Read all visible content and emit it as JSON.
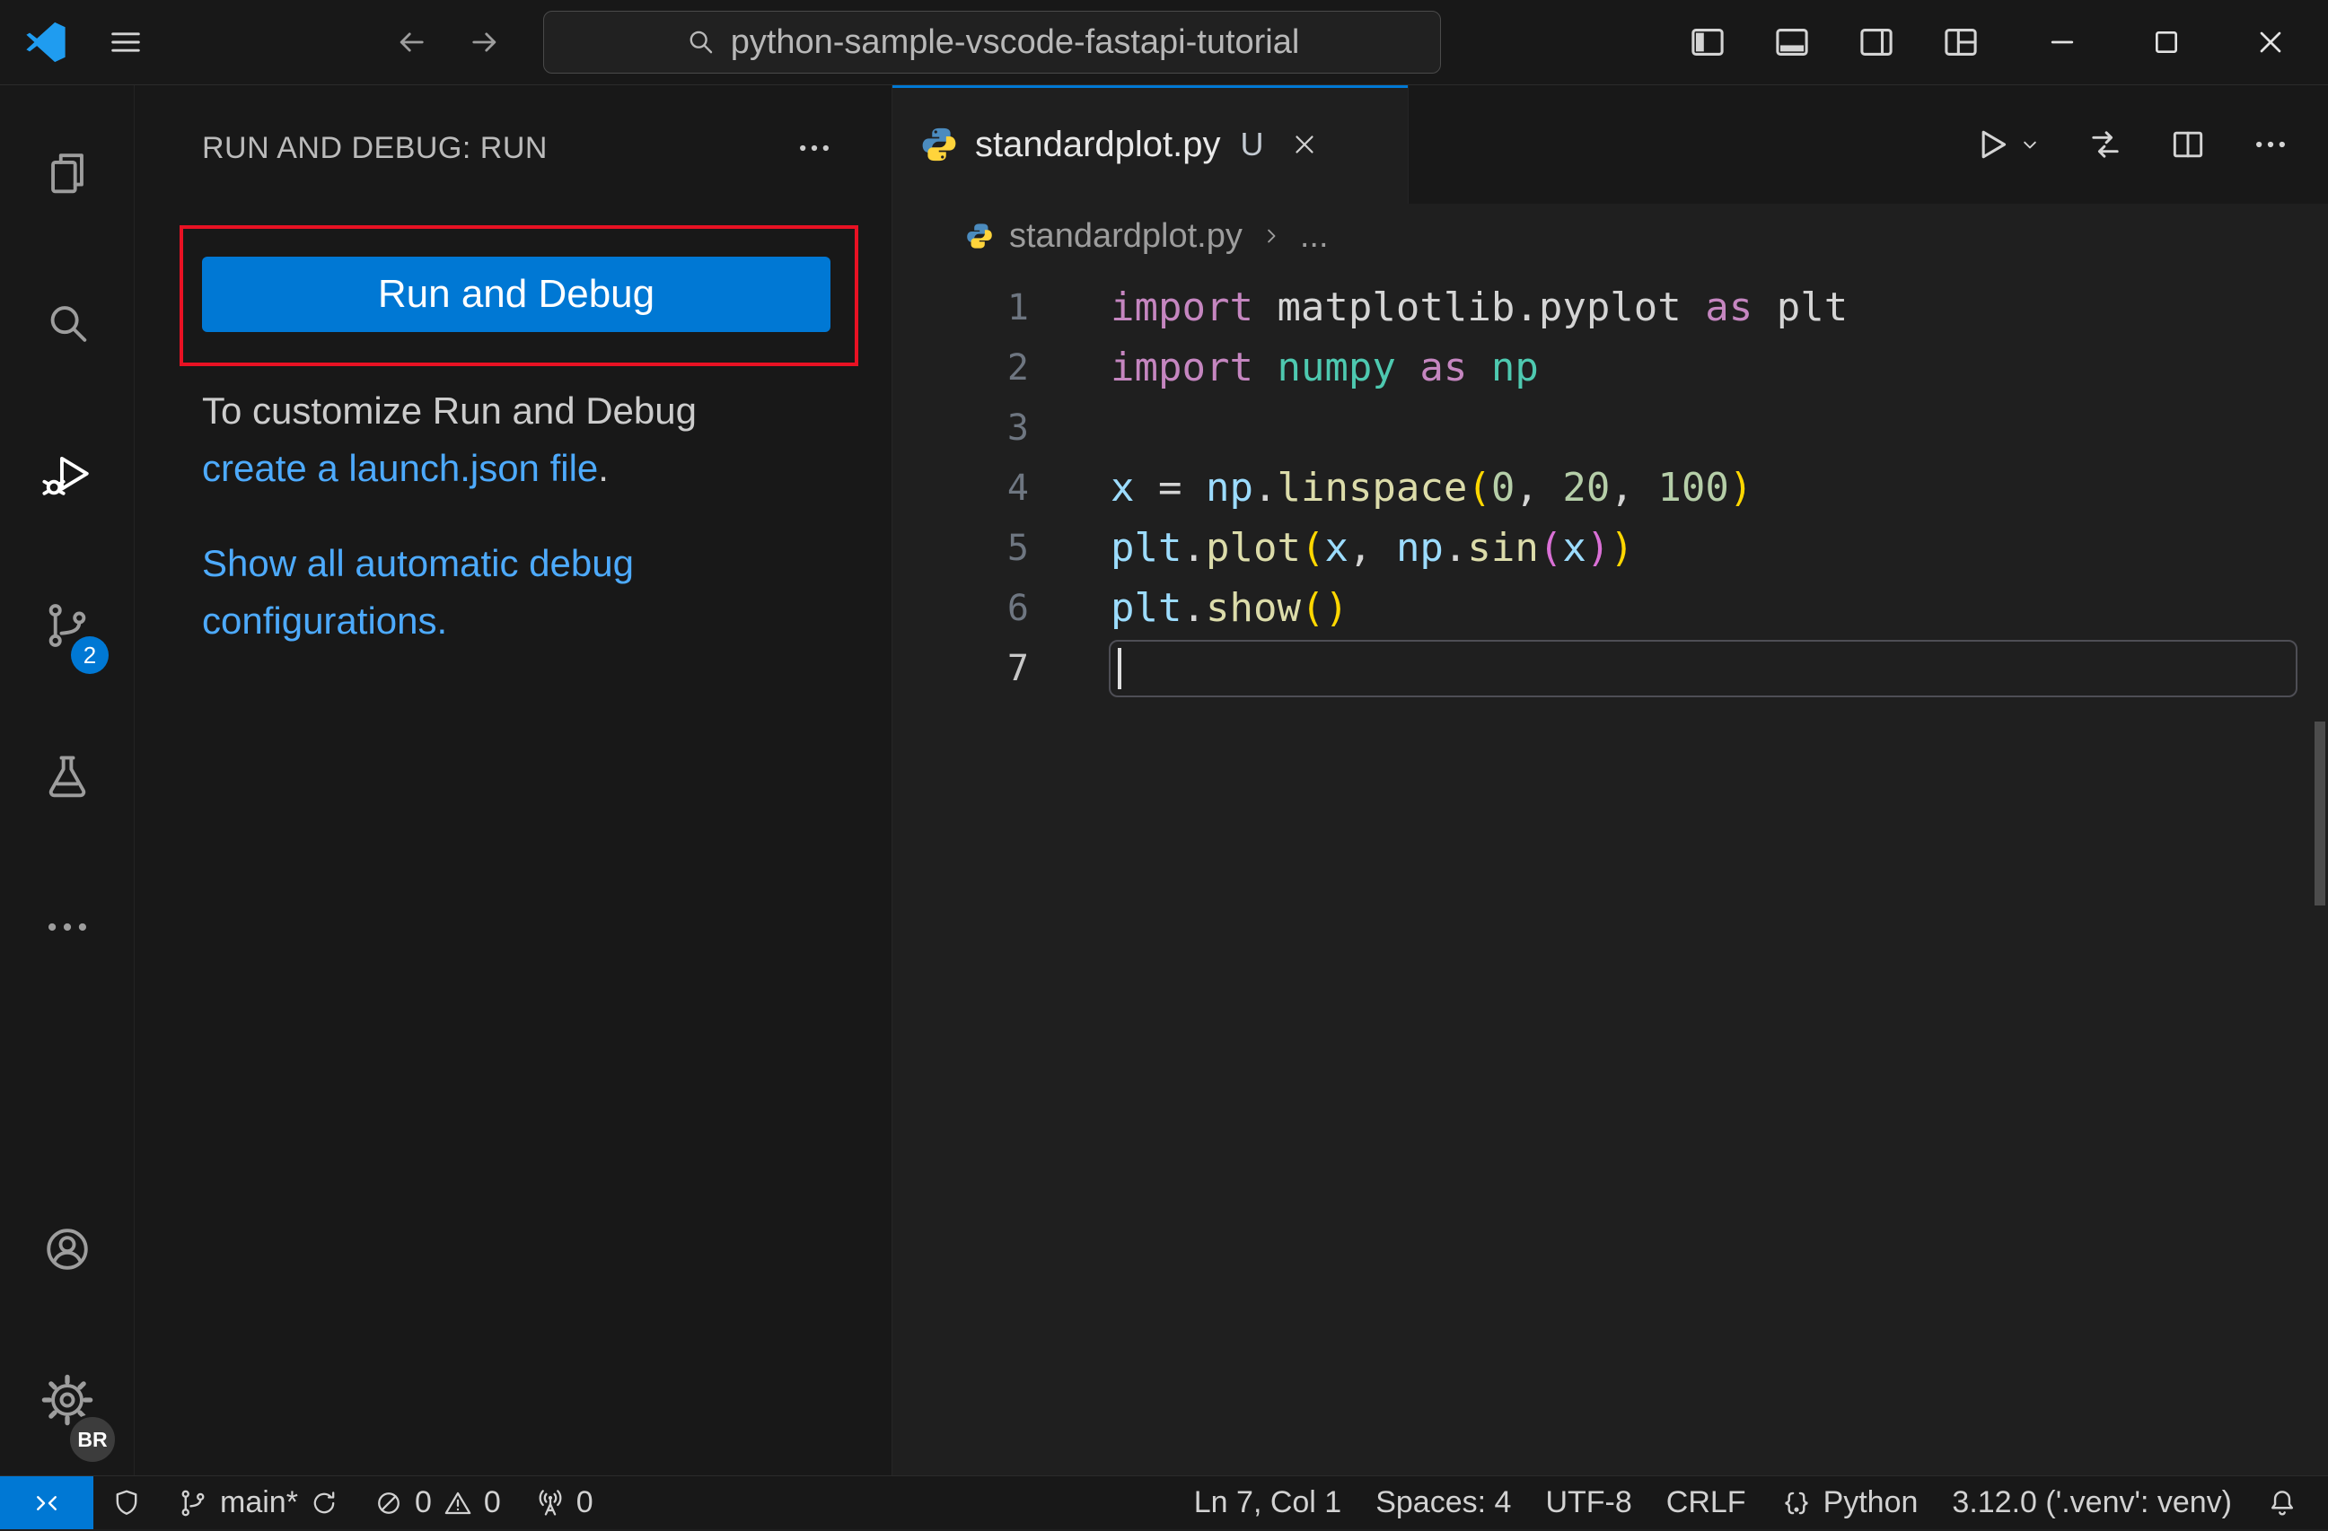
{
  "colors": {
    "accent_blue": "#0078d4",
    "annotation_red": "#e81123",
    "link_blue": "#4daafc"
  },
  "title_bar": {
    "search_value": "python-sample-vscode-fastapi-tutorial"
  },
  "activity_bar": {
    "icons": [
      "files-icon",
      "search-icon",
      "run-debug-icon",
      "source-control-icon",
      "beaker-icon",
      "ellipsis-icon",
      "account-icon",
      "gear-icon"
    ],
    "source_control_badge": "2",
    "profile_badge": "BR"
  },
  "sidebar": {
    "header": "RUN AND DEBUG: RUN",
    "run_button_label": "Run and Debug",
    "customize_text": "To customize Run and Debug",
    "customize_link": "create a launch.json file",
    "customize_period": ".",
    "show_configs_link": "Show all automatic debug configurations."
  },
  "editor": {
    "tab": {
      "label": "standardplot.py",
      "modified_badge": "U"
    },
    "breadcrumb": {
      "file": "standardplot.py",
      "overflow": "..."
    },
    "code": {
      "colors": {
        "kw": "#C586C0",
        "plain": "#D4D4D4",
        "mod": "#4EC9B0",
        "var": "#9CDCFE",
        "number": "#B5CEA8",
        "fn": "#DCDCAA",
        "b1": "#FFD700",
        "b2": "#DA70D6"
      },
      "lines": [
        {
          "num": "1",
          "tokens": [
            [
              "import",
              "kw"
            ],
            [
              " matplotlib.pyplot ",
              "plain"
            ],
            [
              "as",
              "kw"
            ],
            [
              " plt",
              "plain"
            ]
          ]
        },
        {
          "num": "2",
          "tokens": [
            [
              "import",
              "kw"
            ],
            [
              " ",
              "plain"
            ],
            [
              "numpy",
              "mod"
            ],
            [
              " ",
              "plain"
            ],
            [
              "as",
              "kw"
            ],
            [
              " ",
              "plain"
            ],
            [
              "np",
              "mod"
            ]
          ]
        },
        {
          "num": "3",
          "tokens": []
        },
        {
          "num": "4",
          "tokens": [
            [
              "x",
              "var"
            ],
            [
              " = ",
              "plain"
            ],
            [
              "np",
              "var"
            ],
            [
              ".",
              "plain"
            ],
            [
              "linspace",
              "fn"
            ],
            [
              "(",
              "b1"
            ],
            [
              "0",
              "number"
            ],
            [
              ", ",
              "plain"
            ],
            [
              "20",
              "number"
            ],
            [
              ", ",
              "plain"
            ],
            [
              "100",
              "number"
            ],
            [
              ")",
              "b1"
            ]
          ]
        },
        {
          "num": "5",
          "tokens": [
            [
              "plt",
              "var"
            ],
            [
              ".",
              "plain"
            ],
            [
              "plot",
              "fn"
            ],
            [
              "(",
              "b1"
            ],
            [
              "x",
              "var"
            ],
            [
              ", ",
              "plain"
            ],
            [
              "np",
              "var"
            ],
            [
              ".",
              "plain"
            ],
            [
              "sin",
              "fn"
            ],
            [
              "(",
              "b2"
            ],
            [
              "x",
              "var"
            ],
            [
              ")",
              "b2"
            ],
            [
              ")",
              "b1"
            ]
          ]
        },
        {
          "num": "6",
          "tokens": [
            [
              "plt",
              "var"
            ],
            [
              ".",
              "plain"
            ],
            [
              "show",
              "fn"
            ],
            [
              "(",
              "b1"
            ],
            [
              ")",
              "b1"
            ]
          ]
        },
        {
          "num": "7",
          "tokens": [],
          "active": true
        }
      ]
    }
  },
  "status_bar": {
    "branch": "main*",
    "errors": "0",
    "warnings": "0",
    "ports": "0",
    "cursor_position": "Ln 7, Col 1",
    "indentation": "Spaces: 4",
    "encoding": "UTF-8",
    "eol": "CRLF",
    "language": "Python",
    "python_env": "3.12.0 ('.venv': venv)"
  }
}
